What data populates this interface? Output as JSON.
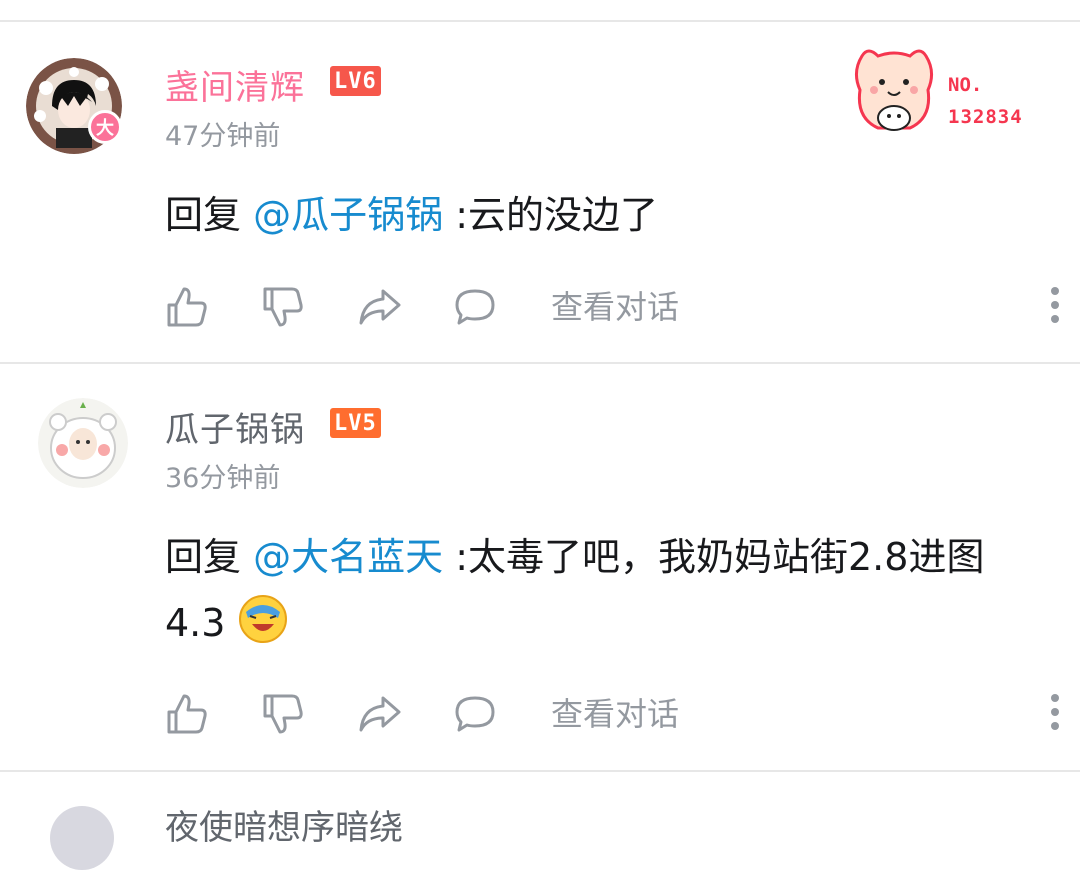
{
  "comments": [
    {
      "username": "盏间清辉",
      "username_color": "#fb7299",
      "level": "LV6",
      "level_color": "#f6574b",
      "avatar_badge": "大",
      "time": "47分钟前",
      "reply_prefix": "回复",
      "mention": "@瓜子锅锅",
      "text": " :云的没边了",
      "fan_badge": {
        "label": "NO.",
        "number": "132834"
      },
      "view_conversation": "查看对话"
    },
    {
      "username": "瓜子锅锅",
      "username_color": "#61666d",
      "level": "LV5",
      "level_color": "#ff6d2f",
      "time": "36分钟前",
      "reply_prefix": "回复",
      "mention": "@大名蓝天",
      "text": " :太毒了吧，我奶妈站街2.8进图",
      "text_line2": "4.3",
      "emoji": "facepalm-laugh-emoji",
      "view_conversation": "查看对话"
    }
  ],
  "partial_next_username": "夜使暗想序暗绕"
}
